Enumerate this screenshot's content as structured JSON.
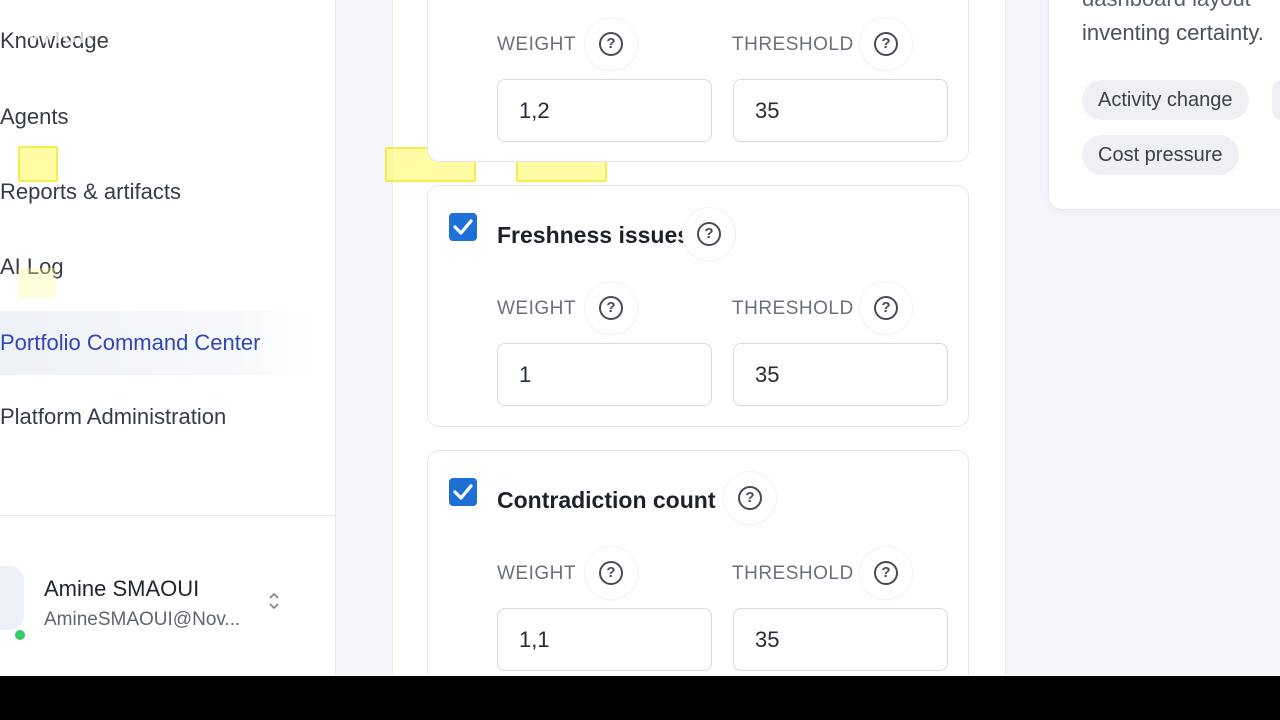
{
  "watermark": "Wick",
  "sidebar": {
    "items": [
      {
        "label": "Knowledge"
      },
      {
        "label": "Agents"
      },
      {
        "label": "Reports & artifacts"
      },
      {
        "label": "AI Log"
      },
      {
        "label": "Portfolio Command Center",
        "active": true
      },
      {
        "label": "Platform Administration"
      }
    ],
    "user": {
      "name": "Amine SMAOUI",
      "email": "AmineSMAOUI@Nov...",
      "status": "online"
    }
  },
  "metrics": [
    {
      "title": "",
      "checked": null,
      "weight_label": "WEIGHT",
      "threshold_label": "THRESHOLD",
      "weight": "1,2",
      "threshold": "35"
    },
    {
      "title": "Freshness issues",
      "checked": true,
      "weight_label": "WEIGHT",
      "threshold_label": "THRESHOLD",
      "weight": "1",
      "threshold": "35"
    },
    {
      "title": "Contradiction count",
      "checked": true,
      "weight_label": "WEIGHT",
      "threshold_label": "THRESHOLD",
      "weight": "1,1",
      "threshold": "35"
    }
  ],
  "help_icon": "question-circle-icon",
  "right_panel": {
    "text_top": "dashboard layout",
    "text": "inventing certainty.",
    "chips": [
      "Activity change",
      "Cost pressure"
    ]
  },
  "colors": {
    "accent": "#2f47b5",
    "checkbox": "#1f70d6",
    "presence": "#35c96a",
    "highlight": "#fffa5a"
  }
}
